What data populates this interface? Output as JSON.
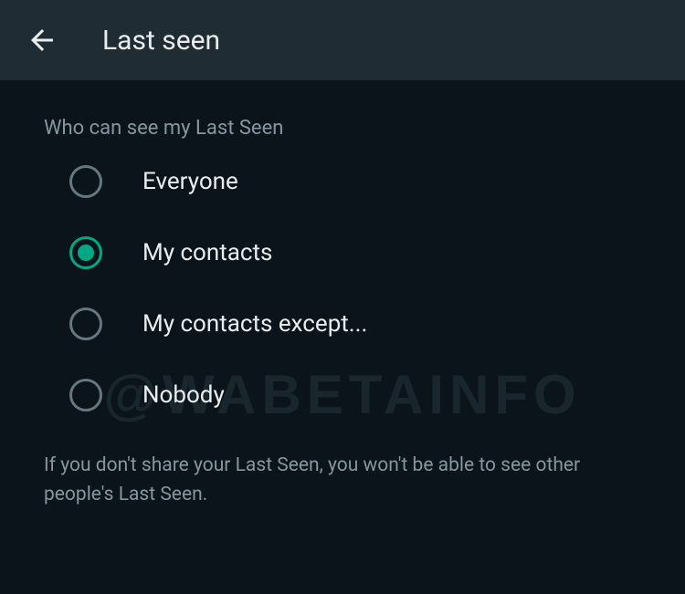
{
  "header": {
    "title": "Last seen"
  },
  "section": {
    "label": "Who can see my Last Seen"
  },
  "options": [
    {
      "label": "Everyone",
      "selected": false
    },
    {
      "label": "My contacts",
      "selected": true
    },
    {
      "label": "My contacts except...",
      "selected": false
    },
    {
      "label": "Nobody",
      "selected": false
    }
  ],
  "help_text": "If you don't share your Last Seen, you won't be able to see other people's Last Seen.",
  "watermark": "@WABETAINFO",
  "colors": {
    "accent": "#00a884",
    "background": "#0b141a",
    "header_bg": "#1f2c33",
    "text_primary": "#e9edef",
    "text_secondary": "#8696a0"
  }
}
